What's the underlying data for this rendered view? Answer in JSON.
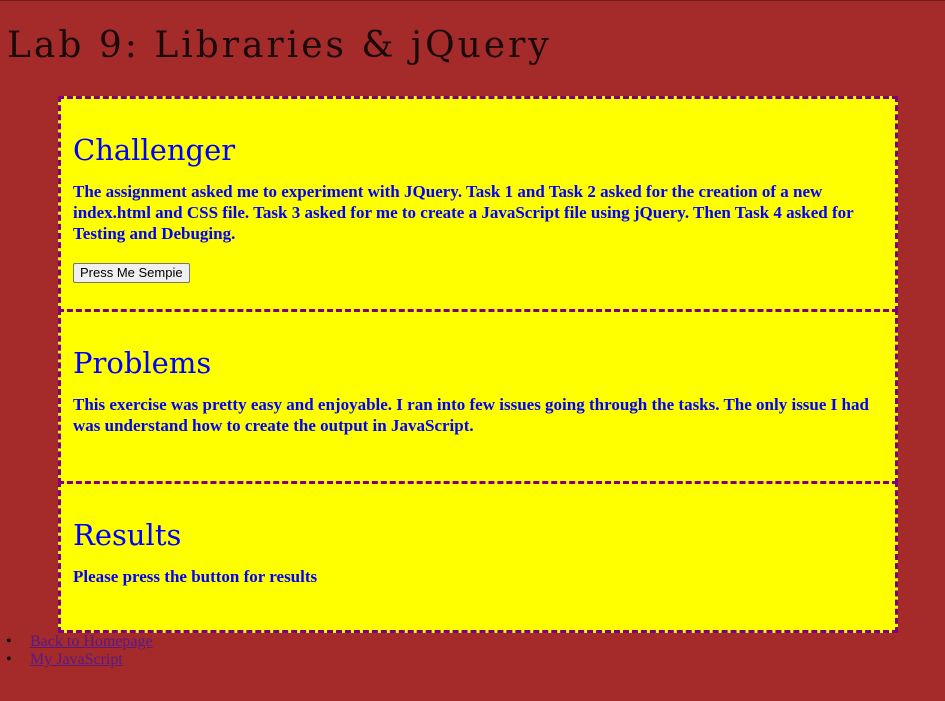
{
  "page": {
    "title": "Lab 9: Libraries & jQuery",
    "background": "#a52a2a"
  },
  "sections": {
    "challenger": {
      "heading": "Challenger",
      "text": "The assignment asked me to experiment with JQuery. Task 1 and Task 2 asked for the creation of a new index.html and CSS file. Task 3 asked for me to create a JavaScript file using jQuery. Then Task 4 asked for Testing and Debuging.",
      "button_label": "Press Me Sempie"
    },
    "problems": {
      "heading": "Problems",
      "text": "This exercise was pretty easy and enjoyable. I ran into few issues going through the tasks. The only issue I had was understand how to create the output in JavaScript."
    },
    "results": {
      "heading": "Results",
      "text": "Please press the button for results"
    }
  },
  "nav": {
    "links": [
      {
        "label": "Back to Homepage"
      },
      {
        "label": "My JavaScript"
      }
    ]
  },
  "colors": {
    "section_bg": "#ffff00",
    "section_border": "#800080",
    "section_text": "#0000ff",
    "link": "#551a8b"
  }
}
